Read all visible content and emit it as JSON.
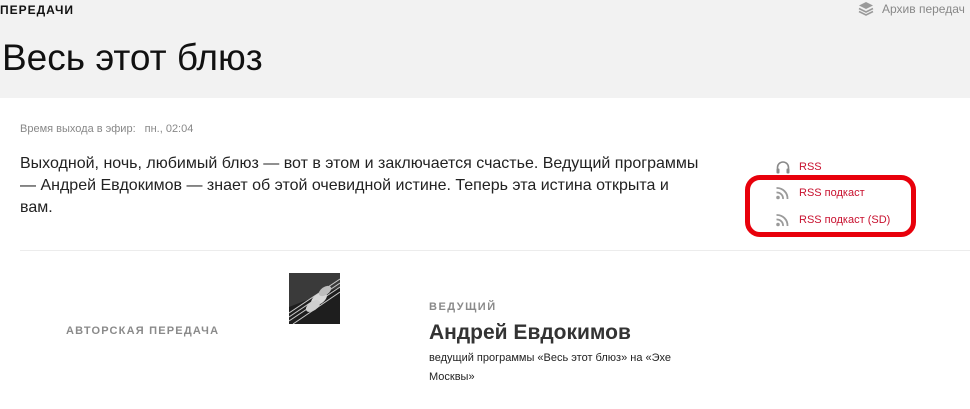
{
  "header": {
    "section": "ПЕРЕДАЧИ",
    "archive_link": "Архив передач",
    "title": "Весь этот блюз"
  },
  "program": {
    "airtime_label": "Время выхода в эфир:",
    "airtime_value": "пн., 02:04",
    "description": "Выходной, ночь, любимый блюз — вот в этом и заключается счастье. Ведущий программы — Андрей Евдокимов — знает об этой очевидной истине. Теперь эта истина открыта и вам."
  },
  "feeds": [
    {
      "label": "RSS",
      "icon": "headphones-icon"
    },
    {
      "label": "RSS подкаст",
      "icon": "rss-icon"
    },
    {
      "label": "RSS подкаст (SD)",
      "icon": "rss-icon"
    }
  ],
  "author_section": {
    "label": "АВТОРСКАЯ ПЕРЕДАЧА"
  },
  "host": {
    "label": "ВЕДУЩИЙ",
    "name": "Андрей Евдокимов",
    "description": "ведущий программы «Весь этот блюз» на «Эхе Москвы»"
  },
  "colors": {
    "accent": "#c8102e",
    "highlight": "#e8000b",
    "header_bg": "#f2f2f2"
  }
}
